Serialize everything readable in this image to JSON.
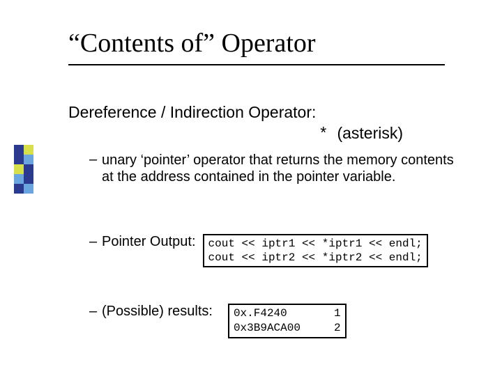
{
  "title": "“Contents of” Operator",
  "subtitle": "Dereference / Indirection Operator:",
  "asterisk": {
    "symbol": "*",
    "label": "(asterisk)"
  },
  "bullets": {
    "b1": "unary ‘pointer’ operator that returns the memory contents at the address contained in the pointer variable.",
    "b2": "Pointer Output:",
    "b3": "(Possible) results:"
  },
  "code": {
    "output": "cout << iptr1 << *iptr1 << endl;\ncout << iptr2 << *iptr2 << endl;",
    "results": "0x.F4240       1\n0x3B9ACA00     2"
  },
  "deco_colors": {
    "r1a": "#2a3a8f",
    "r1b": "#d7df4a",
    "r2a": "#2a3a8f",
    "r2b": "#6aa5e0",
    "r3a": "#d7df4a",
    "r3b": "#2a3a8f",
    "r4a": "#6aa5e0",
    "r4b": "#2a3a8f",
    "r5a": "#2a3a8f",
    "r5b": "#6aa5e0"
  }
}
